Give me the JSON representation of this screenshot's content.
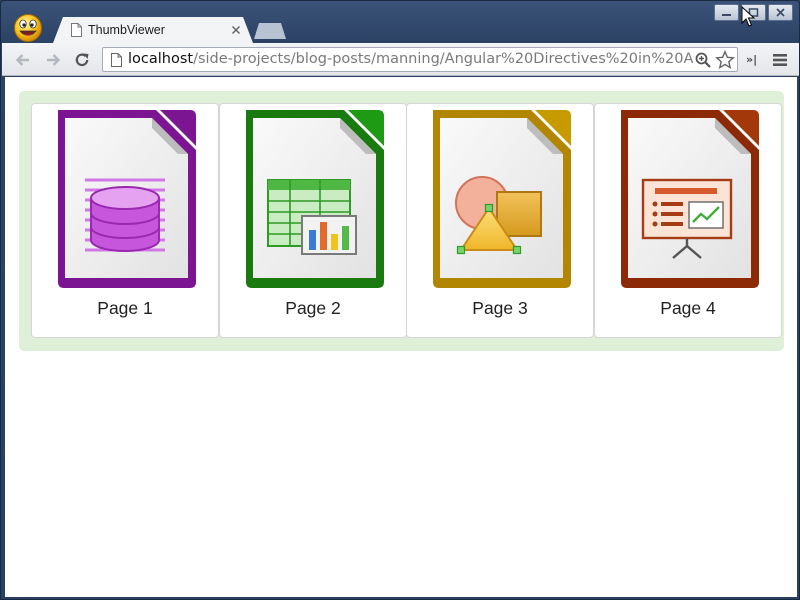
{
  "window": {
    "app_icon": "smiley-face-icon",
    "controls": [
      "minimize-icon",
      "maximize-icon",
      "close-icon"
    ]
  },
  "tabs": [
    {
      "title": "ThumbViewer",
      "icon": "page-icon",
      "active": true
    }
  ],
  "toolbar": {
    "back_icon": "back-arrow-icon",
    "forward_icon": "forward-arrow-icon",
    "reload_icon": "reload-icon",
    "url_host": "localhost",
    "url_path": "/side-projects/blog-posts/manning/Angular%20Directives%20in%20A",
    "zoom_icon": "zoom-icon",
    "bookmark_icon": "star-icon",
    "extensions_label": "»|",
    "menu_icon": "hamburger-menu-icon"
  },
  "thumbnails": {
    "strip_color": "#dff0d8",
    "items": [
      {
        "caption": "Page 1",
        "icon": "database-document-icon",
        "accent": "#8a1b9e"
      },
      {
        "caption": "Page 2",
        "icon": "spreadsheet-document-icon",
        "accent": "#1e8c12"
      },
      {
        "caption": "Page 3",
        "icon": "drawing-document-icon",
        "accent": "#c79a00"
      },
      {
        "caption": "Page 4",
        "icon": "presentation-document-icon",
        "accent": "#a3380a"
      }
    ]
  }
}
